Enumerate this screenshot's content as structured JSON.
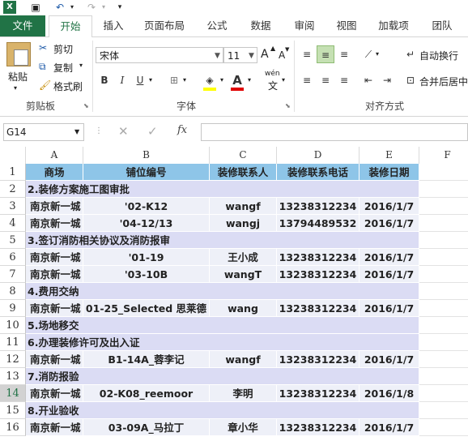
{
  "ribbon_tabs": [
    "文件",
    "开始",
    "插入",
    "页面布局",
    "公式",
    "数据",
    "审阅",
    "视图",
    "加载项",
    "团队"
  ],
  "clipboard": {
    "paste": "粘贴",
    "cut": "剪切",
    "copy": "复制",
    "format_painter": "格式刷",
    "group": "剪贴板"
  },
  "font": {
    "name": "宋体",
    "size": "11",
    "bold": "B",
    "italic": "I",
    "underline": "U",
    "wen": "wén",
    "wen_char": "文",
    "group": "字体",
    "grow": "A",
    "shrink": "A",
    "color_a": "A"
  },
  "alignment": {
    "wrap": "自动换行",
    "merge": "合并后居中",
    "group": "对齐方式"
  },
  "formula_bar": {
    "name_box": "G14",
    "fx": "fx",
    "formula": ""
  },
  "columns": [
    "A",
    "B",
    "C",
    "D",
    "E",
    "F"
  ],
  "rows": [
    {
      "n": "1",
      "type": "hdr",
      "cells": [
        "商场",
        "铺位编号",
        "装修联系人",
        "装修联系电话",
        "装修日期"
      ]
    },
    {
      "n": "2",
      "type": "sec",
      "cells": [
        "2.装修方案施工图审批"
      ]
    },
    {
      "n": "3",
      "type": "dat",
      "cells": [
        "南京新一城",
        "'02-K12",
        "wangf",
        "13238312234",
        "2016/1/7"
      ]
    },
    {
      "n": "4",
      "type": "dat",
      "cells": [
        "南京新一城",
        "'04-12/13",
        "wangj",
        "13794489532",
        "2016/1/7"
      ]
    },
    {
      "n": "5",
      "type": "sec",
      "cells": [
        "3.签订消防相关协议及消防报审"
      ]
    },
    {
      "n": "6",
      "type": "dat",
      "cells": [
        "南京新一城",
        "'01-19",
        "王小成",
        "13238312234",
        "2016/1/7"
      ]
    },
    {
      "n": "7",
      "type": "dat",
      "cells": [
        "南京新一城",
        "'03-10B",
        "wangT",
        "13238312234",
        "2016/1/7"
      ]
    },
    {
      "n": "8",
      "type": "sec",
      "cells": [
        "4.费用交纳"
      ]
    },
    {
      "n": "9",
      "type": "dat",
      "cells": [
        "南京新一城",
        "01-25_Selected 思莱德",
        "wang",
        "13238312234",
        "2016/1/7"
      ]
    },
    {
      "n": "10",
      "type": "sec",
      "cells": [
        "5.场地移交"
      ]
    },
    {
      "n": "11",
      "type": "sec",
      "cells": [
        "6.办理装修许可及出入证"
      ]
    },
    {
      "n": "12",
      "type": "dat",
      "cells": [
        "南京新一城",
        "B1-14A_蓉李记",
        "wangf",
        "13238312234",
        "2016/1/7"
      ]
    },
    {
      "n": "13",
      "type": "sec",
      "cells": [
        "7.消防报验"
      ]
    },
    {
      "n": "14",
      "type": "dat",
      "selected": true,
      "cells": [
        "南京新一城",
        "02-K08_reemoor",
        "李明",
        "13238312234",
        "2016/1/8"
      ]
    },
    {
      "n": "15",
      "type": "sec",
      "cells": [
        "8.开业验收"
      ]
    },
    {
      "n": "16",
      "type": "dat",
      "cells": [
        "南京新一城",
        "03-09A_马拉丁",
        "章小华",
        "13238312234",
        "2016/1/7"
      ]
    }
  ],
  "colors": {
    "excel_green": "#217346",
    "header_fill": "#8ec5e8",
    "section_fill": "#dbdcf4",
    "data_fill": "#eef0f8"
  }
}
